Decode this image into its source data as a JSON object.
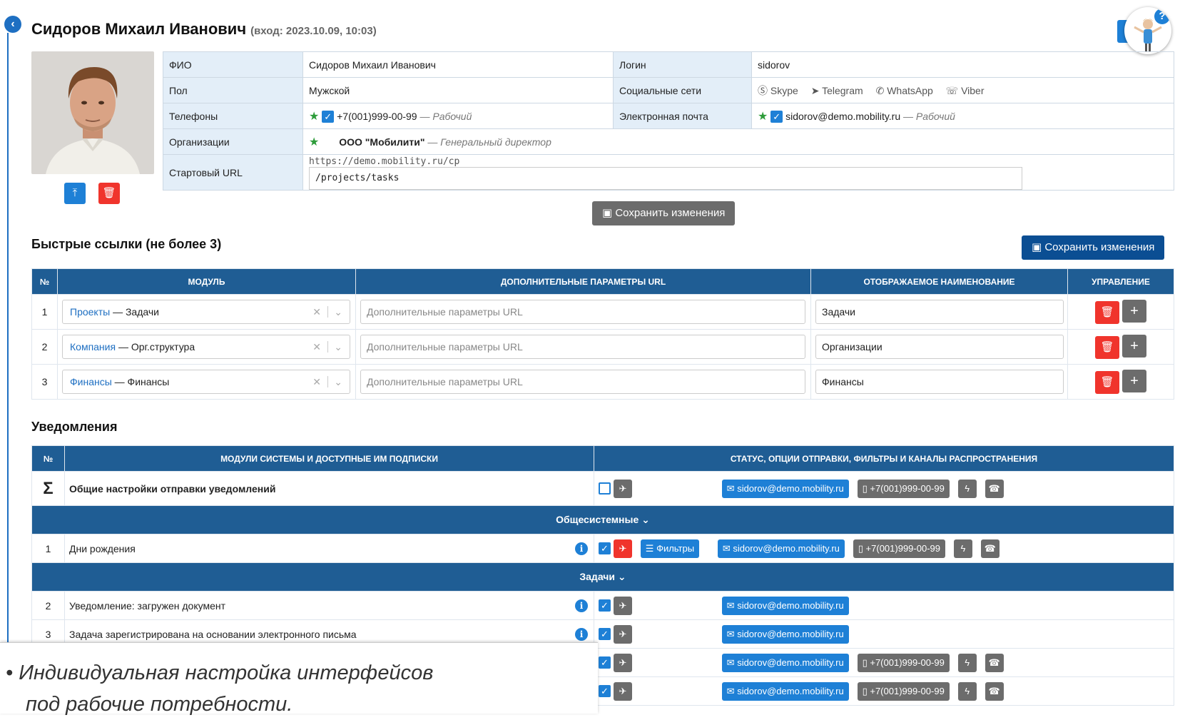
{
  "header": {
    "title": "Сидоров Михаил Иванович",
    "login_info": "(вход: 2023.10.09, 10:03)",
    "corner_button": "Е",
    "help": "?"
  },
  "profile": {
    "fio_label": "ФИО",
    "fio": "Сидоров Михаил Иванович",
    "login_label": "Логин",
    "login": "sidorov",
    "gender_label": "Пол",
    "gender": "Мужской",
    "social_label": "Социальные сети",
    "social": [
      "Skype",
      "Telegram",
      "WhatsApp",
      "Viber"
    ],
    "phones_label": "Телефоны",
    "phone": "+7(001)999-00-99",
    "phone_type": "— Рабочий",
    "email_label": "Электронная почта",
    "email": "sidorov@demo.mobility.ru",
    "email_type": "— Рабочий",
    "org_label": "Организации",
    "org": "ООО \"Мобилити\"",
    "org_role": "— Генеральный директор",
    "url_label": "Стартовый URL",
    "url_prefix": "https://demo.mobility.ru/cp",
    "url_value": "/projects/tasks"
  },
  "save_label": "Сохранить изменения",
  "quick_links": {
    "title": "Быстрые ссылки (не более 3)",
    "headers": [
      "№",
      "МОДУЛЬ",
      "ДОПОЛНИТЕЛЬНЫЕ ПАРАМЕТРЫ URL",
      "ОТОБРАЖАЕМОЕ НАИМЕНОВАНИЕ",
      "УПРАВЛЕНИЕ"
    ],
    "placeholder": "Дополнительные параметры URL",
    "rows": [
      {
        "n": "1",
        "module": "Проекты",
        "sub": "— Задачи",
        "name": "Задачи"
      },
      {
        "n": "2",
        "module": "Компания",
        "sub": "— Орг.структура",
        "name": "Организации"
      },
      {
        "n": "3",
        "module": "Финансы",
        "sub": "— Финансы",
        "name": "Финансы"
      }
    ]
  },
  "notifications": {
    "title": "Уведомления",
    "headers": [
      "№",
      "МОДУЛИ СИСТЕМЫ И ДОСТУПНЫЕ ИМ ПОДПИСКИ",
      "СТАТУС, ОПЦИИ ОТПРАВКИ, ФИЛЬТРЫ И КАНАЛЫ РАСПРОСТРАНЕНИЯ"
    ],
    "general": {
      "n": "Σ",
      "label": "Общие настройки отправки уведомлений"
    },
    "group1": "Общесистемные",
    "group2": "Задачи",
    "filters_label": "Фильтры",
    "rows": [
      {
        "n": "1",
        "label": "Дни рождения"
      },
      {
        "n": "2",
        "label": "Уведомление: загружен документ"
      },
      {
        "n": "3",
        "label": "Задача зарегистрирована на основании электронного письма"
      }
    ],
    "email": "sidorov@demo.mobility.ru",
    "phone": "+7(001)999-00-99"
  },
  "caption": {
    "line1": "Индивидуальная настройка интерфейсов",
    "line2": "под рабочие потребности."
  }
}
